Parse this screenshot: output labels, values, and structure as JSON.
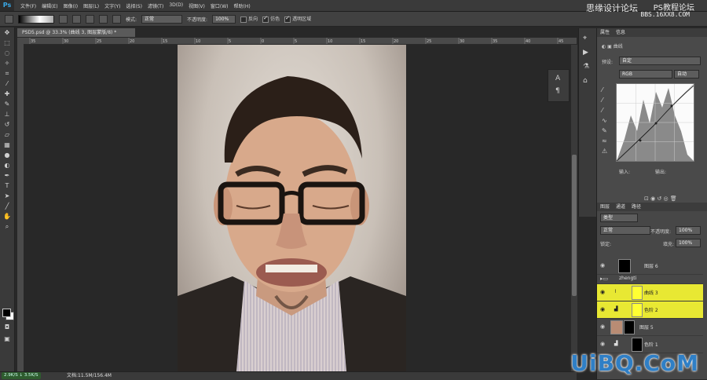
{
  "app": {
    "logo": "Ps"
  },
  "menu": [
    "文件(F)",
    "编辑(E)",
    "图像(I)",
    "图层(L)",
    "文字(Y)",
    "选择(S)",
    "滤镜(T)",
    "3D(D)",
    "视图(V)",
    "窗口(W)",
    "帮助(H)"
  ],
  "watermark": {
    "cn": "思缘设计论坛",
    "cn2": "PS教程论坛",
    "url": "BBS.16XX8.COM",
    "uibq": "UiBQ.CoM"
  },
  "options": {
    "mode_label": "模式:",
    "mode_value": "正常",
    "opacity_label": "不透明度:",
    "opacity_value": "100%",
    "reverse": "反向",
    "dither": "仿色",
    "transparency": "透明区域"
  },
  "document": {
    "tab": "PSD5.psd @ 33.3% (曲线 3, 图层蒙版/8) *",
    "status": "文档:11.5M/156.4M"
  },
  "network": {
    "up": "2.9K/S",
    "down": "3.5K/S"
  },
  "ruler": [
    "35",
    "30",
    "25",
    "20",
    "15",
    "10",
    "5",
    "0",
    "5",
    "10",
    "15",
    "20",
    "25",
    "30",
    "35",
    "40",
    "45"
  ],
  "properties": {
    "tabs": [
      "属性",
      "信息"
    ],
    "title": "曲线",
    "preset_label": "预设:",
    "preset_value": "自定",
    "channel": "RGB",
    "auto": "自动",
    "input_label": "输入:",
    "output_label": "输出:"
  },
  "layers_panel": {
    "tabs": [
      "图层",
      "通道",
      "路径"
    ],
    "filter": "类型",
    "blend": "正常",
    "opacity_label": "不透明度:",
    "opacity_value": "100%",
    "lock_label": "锁定:",
    "fill_label": "填充:",
    "fill_value": "100%",
    "rows": [
      {
        "name": "图层 6"
      },
      {
        "name": "zhengti"
      },
      {
        "name": "曲线 3"
      },
      {
        "name": "色阶 2"
      },
      {
        "name": "图层 5"
      },
      {
        "name": "色阶 1"
      }
    ]
  },
  "colors": {
    "ps_bg": "#282828",
    "highlight": "#e8e833",
    "ps_blue": "#39a8e6"
  }
}
